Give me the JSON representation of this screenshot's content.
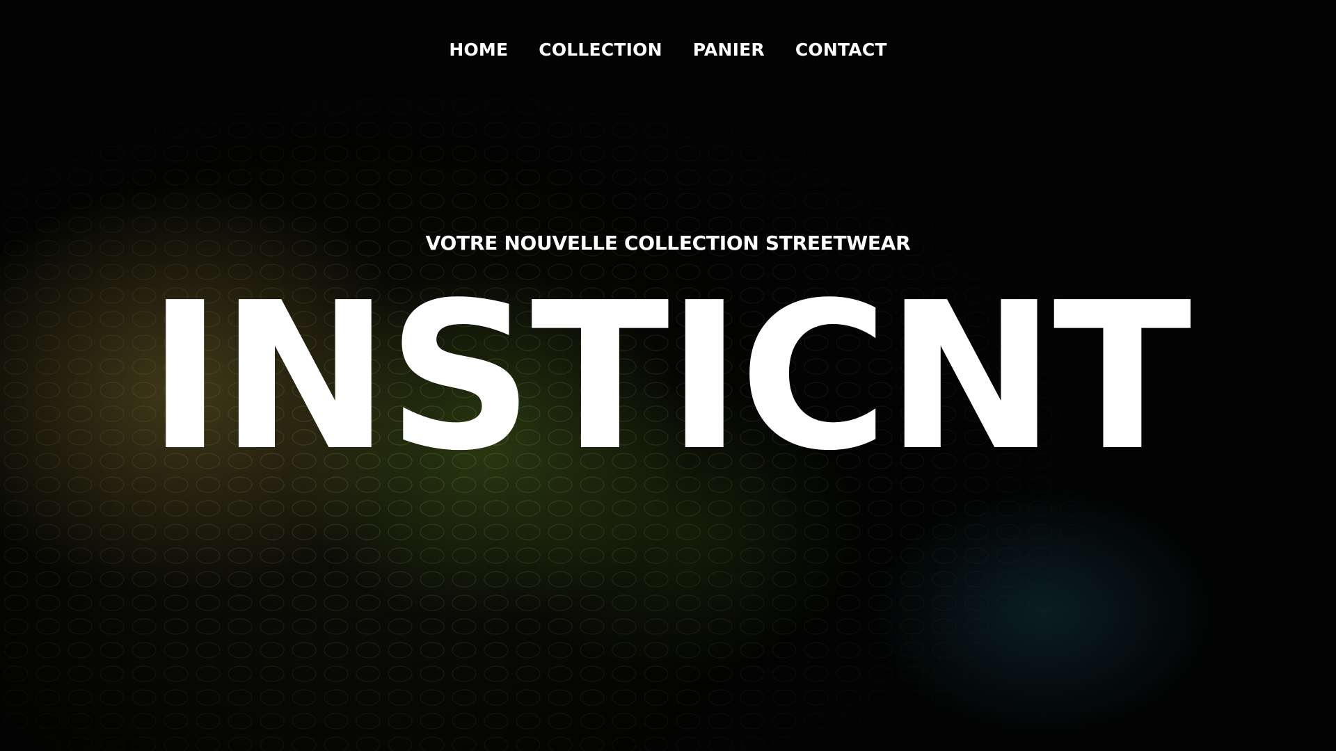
{
  "nav": {
    "items": [
      {
        "label": "HOME"
      },
      {
        "label": "COLLECTION"
      },
      {
        "label": "PANIER"
      },
      {
        "label": "CONTACT"
      }
    ]
  },
  "hero": {
    "subtitle": "VOTRE NOUVELLE COLLECTION STREETWEAR",
    "brand": "INSTICNT"
  },
  "colors": {
    "background": "#020302",
    "text": "#ffffff",
    "glow_warm": "#6e5f28",
    "glow_green": "#506e1e",
    "glow_teal": "#1e5a6e"
  }
}
